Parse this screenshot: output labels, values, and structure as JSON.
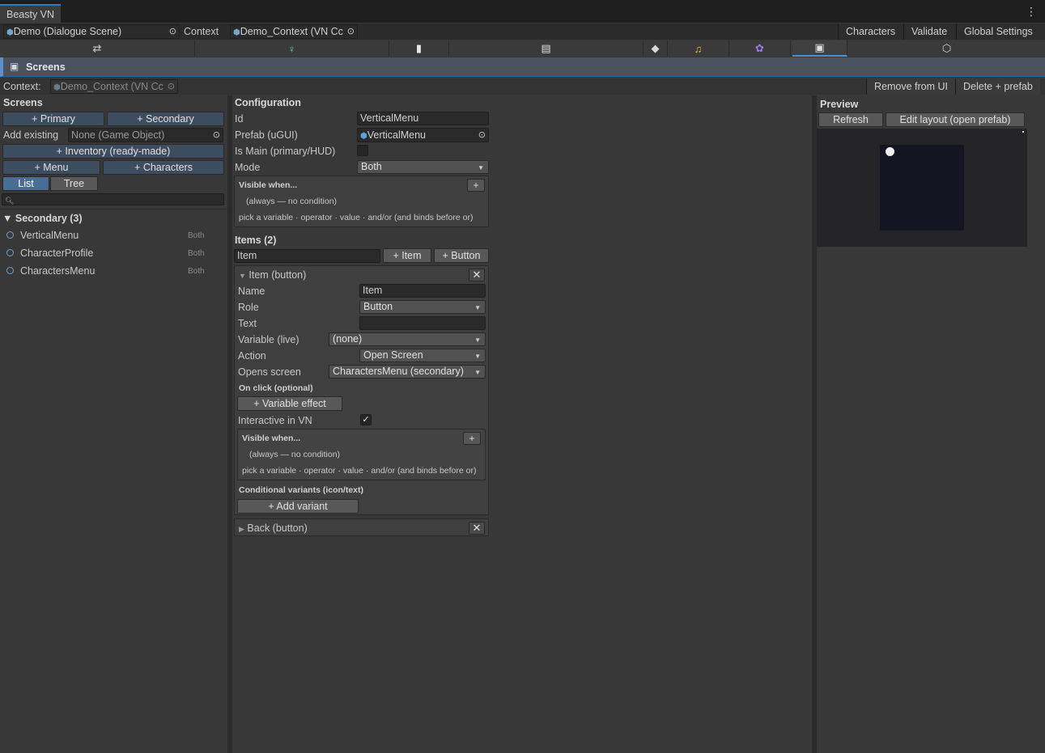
{
  "window": {
    "tab_title": "Beasty VN"
  },
  "context_bar": {
    "scene_field": "Demo (Dialogue Scene)",
    "context_label": "Context",
    "context_field": "Demo_Context (VN Cc",
    "buttons": [
      "Characters",
      "Validate",
      "Global Settings"
    ]
  },
  "toolbar": {
    "icons": [
      "hierarchy-icon",
      "character-icon",
      "page-icon",
      "document-icon",
      "tag-icon",
      "music-icon",
      "cluster-icon",
      "screens-icon",
      "cube-icon"
    ],
    "active": "screens-icon",
    "colors": {
      "character": "#5fd0c0",
      "music": "#e6b84a",
      "cluster": "#9a7be0"
    }
  },
  "section": {
    "title": "Screens"
  },
  "context_row": {
    "label": "Context:",
    "field": "Demo_Context (VN Cc",
    "remove_button": "Remove from UI",
    "delete_button": "Delete + prefab"
  },
  "left": {
    "title": "Screens",
    "add_primary": "+ Primary",
    "add_secondary": "+ Secondary",
    "add_existing_label": "Add existing",
    "add_existing_field": "None (Game Object)",
    "add_inventory": "+ Inventory (ready-made)",
    "add_menu": "+ Menu",
    "add_characters": "+ Characters",
    "view_list": "List",
    "view_tree": "Tree",
    "search_placeholder": "",
    "group_title": "Secondary (3)",
    "items": [
      {
        "name": "VerticalMenu",
        "mode": "Both"
      },
      {
        "name": "CharacterProfile",
        "mode": "Both"
      },
      {
        "name": "CharactersMenu",
        "mode": "Both"
      }
    ]
  },
  "config": {
    "title": "Configuration",
    "id_label": "Id",
    "id_value": "VerticalMenu",
    "prefab_label": "Prefab (uGUI)",
    "prefab_value": "VerticalMenu",
    "is_main_label": "Is Main (primary/HUD)",
    "mode_label": "Mode",
    "mode_value": "Both",
    "visible_title": "Visible when...",
    "visible_always": "(always — no condition)",
    "visible_hint": "pick a variable · operator · value · and/or  (and binds before or)"
  },
  "items": {
    "title": "Items (2)",
    "new_name": "Item",
    "add_item": "+ Item",
    "add_button": "+ Button",
    "entries": [
      {
        "header": "Item   (button)",
        "name_label": "Name",
        "name_value": "Item",
        "role_label": "Role",
        "role_value": "Button",
        "text_label": "Text",
        "text_value": "",
        "variable_label": "Variable (live)",
        "variable_value": "(none)",
        "action_label": "Action",
        "action_value": "Open Screen",
        "opens_label": "Opens screen",
        "opens_value": "CharactersMenu  (secondary)",
        "onclick_label": "On click (optional)",
        "variable_effect": "+ Variable effect",
        "interactive_label": "Interactive in VN",
        "visible_title": "Visible when...",
        "visible_always": "(always — no condition)",
        "visible_hint": "pick a variable · operator · value · and/or  (and binds before or)",
        "variants_label": "Conditional variants (icon/text)",
        "add_variant": "+ Add variant"
      },
      {
        "header": "Back   (button)"
      }
    ]
  },
  "preview": {
    "title": "Preview",
    "refresh": "Refresh",
    "edit_layout": "Edit layout (open prefab)"
  }
}
